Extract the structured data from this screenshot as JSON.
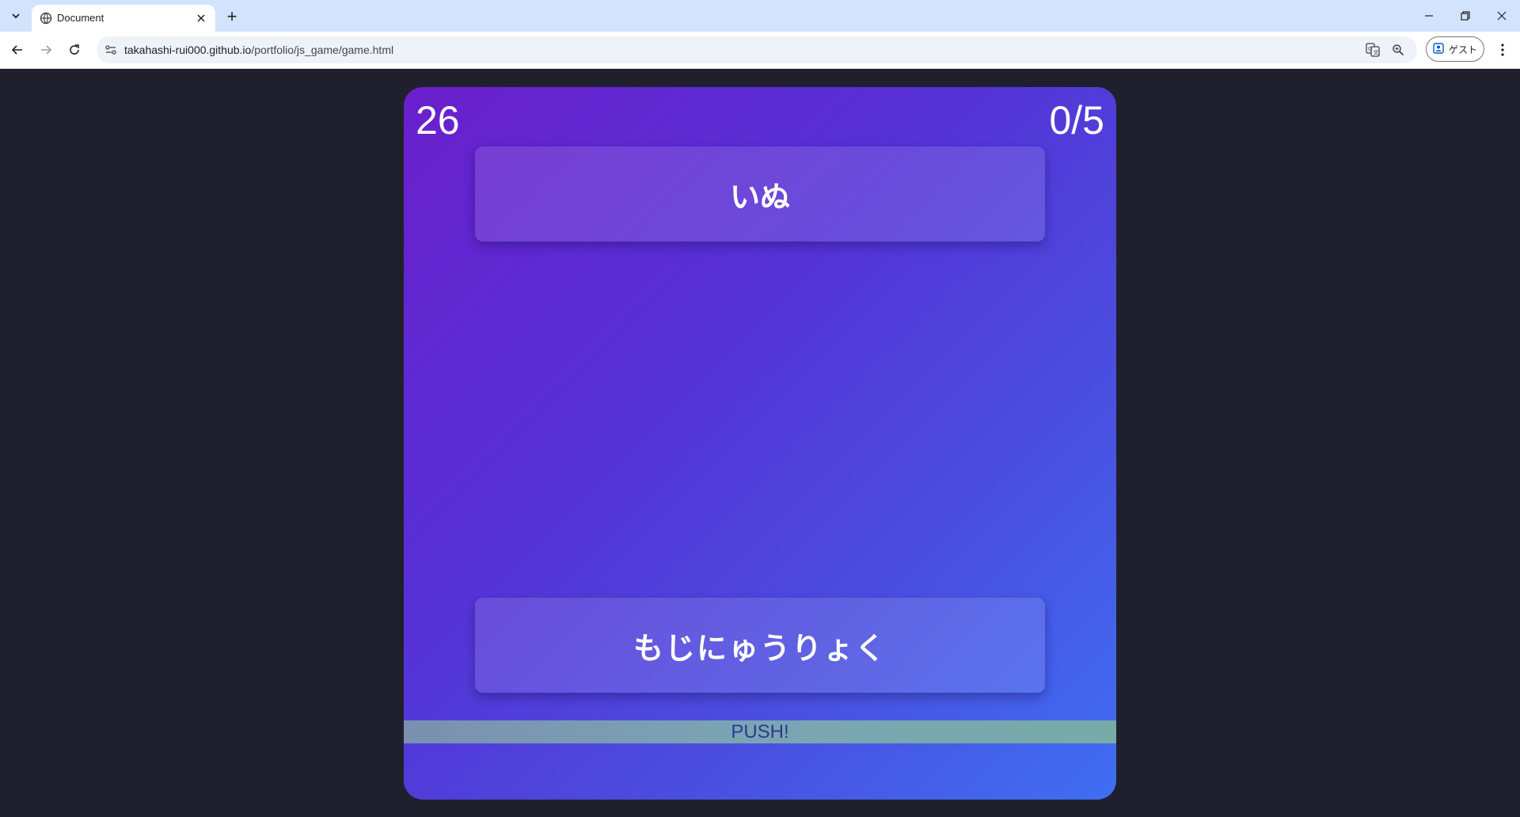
{
  "browser": {
    "tab_title": "Document",
    "new_tab_symbol": "+",
    "url_host": "takahashi-rui000.github.io",
    "url_path": "/portfolio/js_game/game.html",
    "profile_label": "ゲスト",
    "icons": [
      "tab-list-icon",
      "globe-icon",
      "close-icon",
      "back-icon",
      "forward-icon",
      "reload-icon",
      "site-info-icon",
      "translate-icon",
      "zoom-icon",
      "profile-icon",
      "more-menu-icon",
      "minimize-icon",
      "restore-icon",
      "window-close-icon"
    ]
  },
  "game": {
    "timer": "26",
    "score": "0/5",
    "word": "いぬ",
    "input_prompt": "もじにゅうりょく",
    "push_label": "PUSH!"
  },
  "colors": {
    "page_background": "#1f1f2e",
    "game_gradient_start": "#6a1fcc",
    "game_gradient_end": "#3f6ef2",
    "push_text": "#2d3a8c",
    "tabbar": "#d3e3fd"
  }
}
